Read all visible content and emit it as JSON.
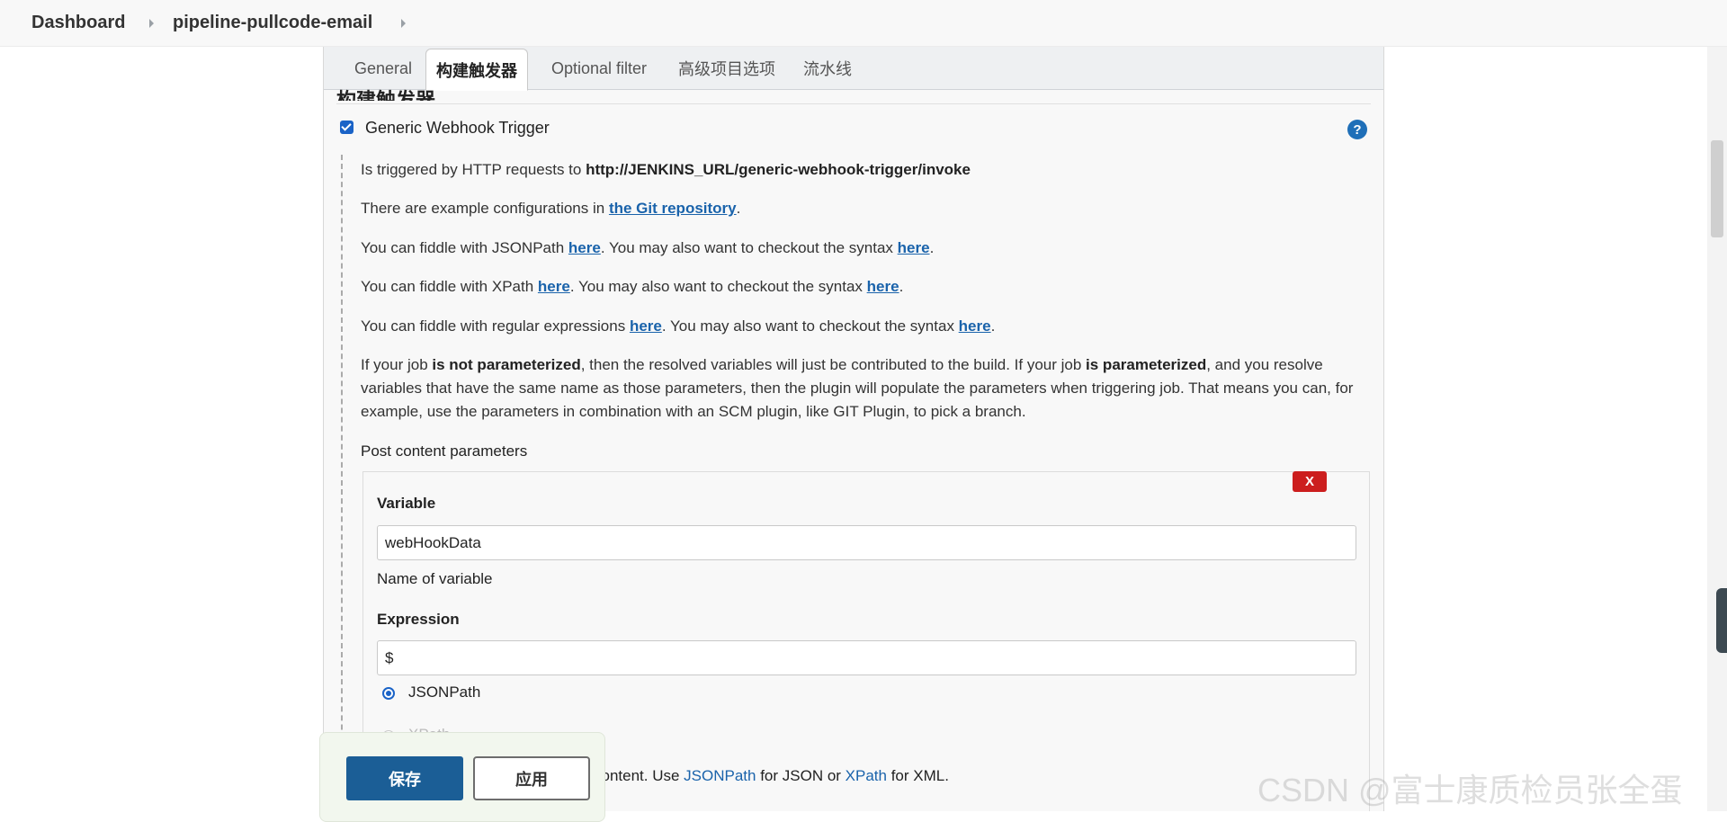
{
  "breadcrumb": {
    "items": [
      "Dashboard",
      "pipeline-pullcode-email"
    ]
  },
  "tabs": [
    {
      "label": "General",
      "active": false
    },
    {
      "label": "构建触发器",
      "active": true
    },
    {
      "label": "Optional filter",
      "active": false
    },
    {
      "label": "高级项目选项",
      "active": false
    },
    {
      "label": "流水线",
      "active": false
    }
  ],
  "section": {
    "title": "构建触发器"
  },
  "trigger": {
    "checkbox_label": "Generic Webhook Trigger",
    "checked": true,
    "help_icon": "?"
  },
  "description": {
    "p1_text": "Is triggered by HTTP requests to ",
    "p1_url": "http://JENKINS_URL/generic-webhook-trigger/invoke",
    "p2_text": "There are example configurations in ",
    "p2_link": "the Git repository",
    "p3_a": "You can fiddle with JSONPath ",
    "p3_b": ". You may also want to checkout the syntax ",
    "p4_a": "You can fiddle with XPath ",
    "p4_b": ". You may also want to checkout the syntax ",
    "p5_a": "You can fiddle with regular expressions ",
    "p5_b": ". You may also want to checkout the syntax ",
    "link_here": "here",
    "period": ".",
    "p6_a": "If your job ",
    "p6_bold1": "is not parameterized",
    "p6_b": ", then the resolved variables will just be contributed to the build. If your job ",
    "p6_bold2": "is parameterized",
    "p6_c": ", and you resolve variables that have the same name as those parameters, then the plugin will populate the parameters when triggering job. That means you can, for example, use the parameters in combination with an SCM plugin, like GIT Plugin, to pick a branch."
  },
  "post_params": {
    "heading": "Post content parameters",
    "delete_label": "X",
    "variable_label": "Variable",
    "variable_value": "webHookData",
    "variable_hint": "Name of variable",
    "expression_label": "Expression",
    "expression_value": "$",
    "radio_jsonpath": "JSONPath",
    "radio_xpath": "XPath",
    "selected": "JSONPath",
    "hint_a": "content. Use ",
    "hint_link1": "JSONPath",
    "hint_b": " for JSON or ",
    "hint_link2": "XPath",
    "hint_c": " for XML."
  },
  "actions": {
    "save_label": "保存",
    "apply_label": "应用"
  },
  "watermark": "CSDN @富士康质检员张全蛋",
  "colors": {
    "primary": "#1b5e96",
    "danger": "#cc1e1e",
    "link": "#1a63ab"
  }
}
